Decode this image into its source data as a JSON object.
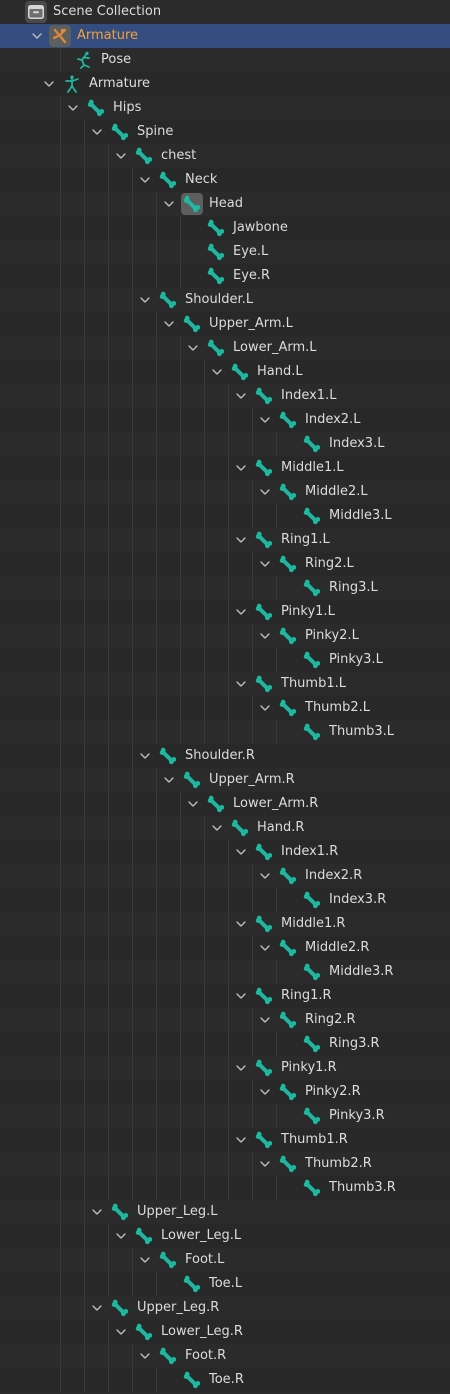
{
  "panel": "outliner",
  "colors": {
    "background": "#2b2b2b",
    "row_alt": "#282828",
    "selected_row": "#334d80",
    "selected_text": "#f5a035",
    "text": "#dcdcdc",
    "bone_icon": "#1fb9a3",
    "armature_icon": "#e08a3c"
  },
  "rows": [
    {
      "label": "Scene Collection",
      "depth": 0,
      "expand": "none",
      "icon": "scene-collection-icon"
    },
    {
      "label": "Armature",
      "depth": 1,
      "expand": "open",
      "icon": "armature-object-icon",
      "selected": true
    },
    {
      "label": "Pose",
      "depth": 2,
      "expand": "none",
      "icon": "pose-icon"
    },
    {
      "label": "Armature",
      "depth": 1.5,
      "expand": "open",
      "icon": "armature-data-icon"
    },
    {
      "label": "Hips",
      "depth": 2.5,
      "expand": "open",
      "icon": "bone-icon"
    },
    {
      "label": "Spine",
      "depth": 3.5,
      "expand": "open",
      "icon": "bone-icon"
    },
    {
      "label": "chest",
      "depth": 4.5,
      "expand": "open",
      "icon": "bone-icon"
    },
    {
      "label": "Neck",
      "depth": 5.5,
      "expand": "open",
      "icon": "bone-icon"
    },
    {
      "label": "Head",
      "depth": 6.5,
      "expand": "open",
      "icon": "bone-icon",
      "active": true
    },
    {
      "label": "Jawbone",
      "depth": 7.5,
      "expand": "none",
      "icon": "bone-icon"
    },
    {
      "label": "Eye.L",
      "depth": 7.5,
      "expand": "none",
      "icon": "bone-icon"
    },
    {
      "label": "Eye.R",
      "depth": 7.5,
      "expand": "none",
      "icon": "bone-icon"
    },
    {
      "label": "Shoulder.L",
      "depth": 5.5,
      "expand": "open",
      "icon": "bone-icon"
    },
    {
      "label": "Upper_Arm.L",
      "depth": 6.5,
      "expand": "open",
      "icon": "bone-icon"
    },
    {
      "label": "Lower_Arm.L",
      "depth": 7.5,
      "expand": "open",
      "icon": "bone-icon"
    },
    {
      "label": "Hand.L",
      "depth": 8.5,
      "expand": "open",
      "icon": "bone-icon"
    },
    {
      "label": "Index1.L",
      "depth": 9.5,
      "expand": "open",
      "icon": "bone-icon"
    },
    {
      "label": "Index2.L",
      "depth": 10.5,
      "expand": "open",
      "icon": "bone-icon"
    },
    {
      "label": "Index3.L",
      "depth": 11.5,
      "expand": "none",
      "icon": "bone-icon"
    },
    {
      "label": "Middle1.L",
      "depth": 9.5,
      "expand": "open",
      "icon": "bone-icon"
    },
    {
      "label": "Middle2.L",
      "depth": 10.5,
      "expand": "open",
      "icon": "bone-icon"
    },
    {
      "label": "Middle3.L",
      "depth": 11.5,
      "expand": "none",
      "icon": "bone-icon"
    },
    {
      "label": "Ring1.L",
      "depth": 9.5,
      "expand": "open",
      "icon": "bone-icon"
    },
    {
      "label": "Ring2.L",
      "depth": 10.5,
      "expand": "open",
      "icon": "bone-icon"
    },
    {
      "label": "Ring3.L",
      "depth": 11.5,
      "expand": "none",
      "icon": "bone-icon"
    },
    {
      "label": "Pinky1.L",
      "depth": 9.5,
      "expand": "open",
      "icon": "bone-icon"
    },
    {
      "label": "Pinky2.L",
      "depth": 10.5,
      "expand": "open",
      "icon": "bone-icon"
    },
    {
      "label": "Pinky3.L",
      "depth": 11.5,
      "expand": "none",
      "icon": "bone-icon"
    },
    {
      "label": "Thumb1.L",
      "depth": 9.5,
      "expand": "open",
      "icon": "bone-icon"
    },
    {
      "label": "Thumb2.L",
      "depth": 10.5,
      "expand": "open",
      "icon": "bone-icon"
    },
    {
      "label": "Thumb3.L",
      "depth": 11.5,
      "expand": "none",
      "icon": "bone-icon"
    },
    {
      "label": "Shoulder.R",
      "depth": 5.5,
      "expand": "open",
      "icon": "bone-icon"
    },
    {
      "label": "Upper_Arm.R",
      "depth": 6.5,
      "expand": "open",
      "icon": "bone-icon"
    },
    {
      "label": "Lower_Arm.R",
      "depth": 7.5,
      "expand": "open",
      "icon": "bone-icon"
    },
    {
      "label": "Hand.R",
      "depth": 8.5,
      "expand": "open",
      "icon": "bone-icon"
    },
    {
      "label": "Index1.R",
      "depth": 9.5,
      "expand": "open",
      "icon": "bone-icon"
    },
    {
      "label": "Index2.R",
      "depth": 10.5,
      "expand": "open",
      "icon": "bone-icon"
    },
    {
      "label": "Index3.R",
      "depth": 11.5,
      "expand": "none",
      "icon": "bone-icon"
    },
    {
      "label": "Middle1.R",
      "depth": 9.5,
      "expand": "open",
      "icon": "bone-icon"
    },
    {
      "label": "Middle2.R",
      "depth": 10.5,
      "expand": "open",
      "icon": "bone-icon"
    },
    {
      "label": "Middle3.R",
      "depth": 11.5,
      "expand": "none",
      "icon": "bone-icon"
    },
    {
      "label": "Ring1.R",
      "depth": 9.5,
      "expand": "open",
      "icon": "bone-icon"
    },
    {
      "label": "Ring2.R",
      "depth": 10.5,
      "expand": "open",
      "icon": "bone-icon"
    },
    {
      "label": "Ring3.R",
      "depth": 11.5,
      "expand": "none",
      "icon": "bone-icon"
    },
    {
      "label": "Pinky1.R",
      "depth": 9.5,
      "expand": "open",
      "icon": "bone-icon"
    },
    {
      "label": "Pinky2.R",
      "depth": 10.5,
      "expand": "open",
      "icon": "bone-icon"
    },
    {
      "label": "Pinky3.R",
      "depth": 11.5,
      "expand": "none",
      "icon": "bone-icon"
    },
    {
      "label": "Thumb1.R",
      "depth": 9.5,
      "expand": "open",
      "icon": "bone-icon"
    },
    {
      "label": "Thumb2.R",
      "depth": 10.5,
      "expand": "open",
      "icon": "bone-icon"
    },
    {
      "label": "Thumb3.R",
      "depth": 11.5,
      "expand": "none",
      "icon": "bone-icon"
    },
    {
      "label": "Upper_Leg.L",
      "depth": 3.5,
      "expand": "open",
      "icon": "bone-icon"
    },
    {
      "label": "Lower_Leg.L",
      "depth": 4.5,
      "expand": "open",
      "icon": "bone-icon"
    },
    {
      "label": "Foot.L",
      "depth": 5.5,
      "expand": "open",
      "icon": "bone-icon"
    },
    {
      "label": "Toe.L",
      "depth": 6.5,
      "expand": "none",
      "icon": "bone-icon"
    },
    {
      "label": "Upper_Leg.R",
      "depth": 3.5,
      "expand": "open",
      "icon": "bone-icon"
    },
    {
      "label": "Lower_Leg.R",
      "depth": 4.5,
      "expand": "open",
      "icon": "bone-icon"
    },
    {
      "label": "Foot.R",
      "depth": 5.5,
      "expand": "open",
      "icon": "bone-icon"
    },
    {
      "label": "Toe.R",
      "depth": 6.5,
      "expand": "none",
      "icon": "bone-icon"
    }
  ]
}
